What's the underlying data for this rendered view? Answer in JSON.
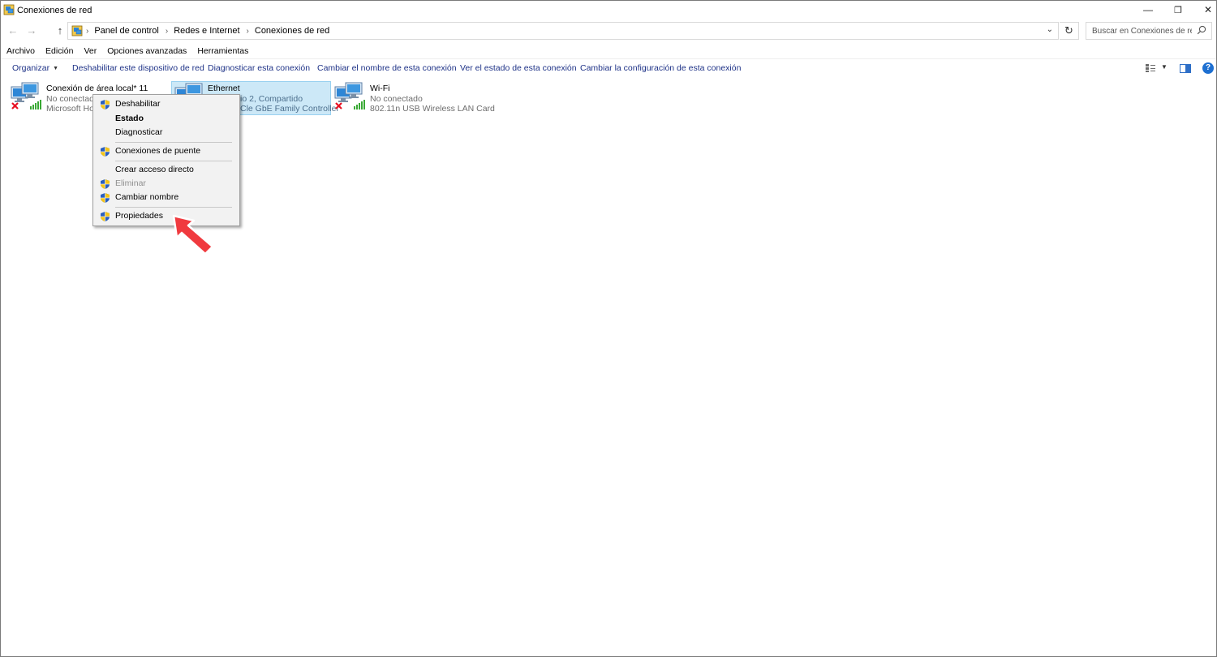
{
  "window": {
    "title": "Conexiones de red",
    "controls": {
      "minimize": "—",
      "restore": "❐",
      "close": "✕"
    }
  },
  "nav": {
    "back": "←",
    "forward": "→",
    "up": "↑"
  },
  "address": {
    "crumbs": [
      "Panel de control",
      "Redes e Internet",
      "Conexiones de red"
    ],
    "dropdown": "⌄",
    "refresh": "↻"
  },
  "search": {
    "placeholder": "Buscar en Conexiones de red"
  },
  "menubar": [
    "Archivo",
    "Edición",
    "Ver",
    "Opciones avanzadas",
    "Herramientas"
  ],
  "commands": {
    "organize": "Organizar",
    "disable": "Deshabilitar este dispositivo de red",
    "diagnose": "Diagnosticar esta conexión",
    "rename": "Cambiar el nombre de esta conexión",
    "status": "Ver el estado de esta conexión",
    "settings": "Cambiar la configuración de esta conexión"
  },
  "help": "?",
  "connections": [
    {
      "name": "Conexión de área local* 11",
      "status": "No conectado",
      "device": "Microsoft Hos",
      "state": "disconnected"
    },
    {
      "name": "Ethernet",
      "status": "io 2, Compartido",
      "device": "Cle GbE Family Controller",
      "state": "connected"
    },
    {
      "name": "Wi-Fi",
      "status": "No conectado",
      "device": "802.11n USB Wireless LAN Card",
      "state": "disconnected"
    }
  ],
  "context_menu": {
    "disable": "Deshabilitar",
    "status": "Estado",
    "diagnose": "Diagnosticar",
    "bridge": "Conexiones de puente",
    "shortcut": "Crear acceso directo",
    "delete": "Eliminar",
    "rename": "Cambiar nombre",
    "properties": "Propiedades"
  },
  "colors": {
    "command_text": "#1e3287",
    "selection_bg": "#cce8f7",
    "pointer_arrow": "#f03a3f",
    "error_x": "#e81123",
    "signal_green": "#3aa935"
  }
}
